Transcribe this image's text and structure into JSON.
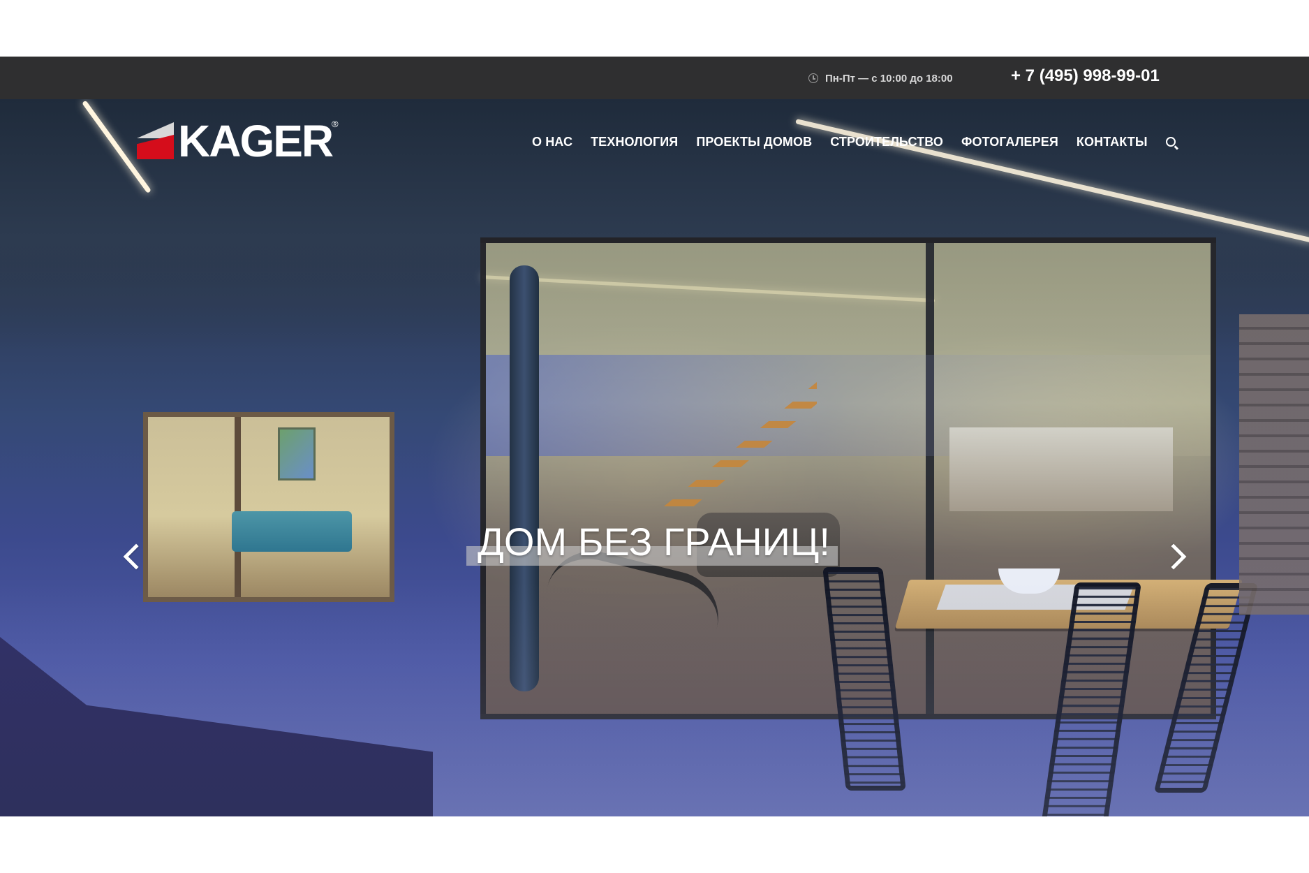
{
  "topbar": {
    "hours": "Пн-Пт — с 10:00 до 18:00",
    "phone": "+ 7 (495) 998-99-01"
  },
  "header": {
    "logo_text": "KAGER",
    "logo_reg": "®",
    "nav": [
      "О НАС",
      "ТЕХНОЛОГИЯ",
      "ПРОЕКТЫ ДОМОВ",
      "СТРОИТЕЛЬСТВО",
      "ФОТОГАЛЕРЕЯ",
      "КОНТАКТЫ"
    ]
  },
  "hero": {
    "title": "ДОМ БЕЗ ГРАНИЦ!"
  },
  "icons": {
    "clock": "clock-icon",
    "search": "search-icon",
    "left_arrow": "chevron-left-icon",
    "right_arrow": "chevron-right-icon"
  },
  "colors": {
    "topbar": "#2f2f30",
    "logo_red": "#d50d1b",
    "text_white": "#ffffff"
  }
}
